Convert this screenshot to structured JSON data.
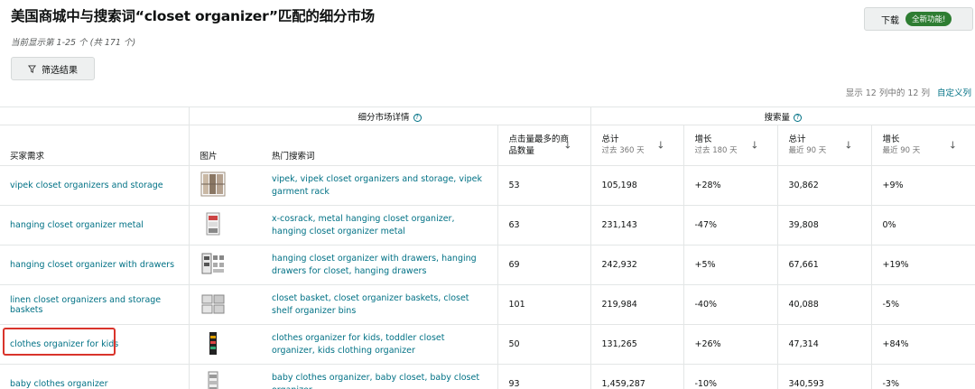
{
  "header": {
    "title": "美国商城中与搜索词“closet organizer”匹配的细分市场",
    "subtitle": "当前显示第 1-25 个 (共 171 个)",
    "download_label": "下载",
    "new_feature_badge": "全新功能!",
    "filter_label": "筛选结果",
    "column_info": "显示 12 列中的 12 列",
    "customize_label": "自定义列"
  },
  "table": {
    "group_headers": {
      "niche_details": "细分市场详情",
      "search_volume": "搜索量"
    },
    "columns": {
      "need": "买家需求",
      "image": "图片",
      "keywords": "热门搜索词",
      "clicked_products": "点击量最多的商品数量",
      "total": "总计",
      "total_sub_360": "过去 360 天",
      "growth": "增长",
      "growth_sub_180": "过去 180 天",
      "total_90": "总计",
      "total_sub_90": "最近 90 天",
      "growth_90": "增长",
      "growth_sub_90": "最近 90 天"
    },
    "rows": [
      {
        "need": "vipek closet organizers and storage",
        "keywords": "vipek, vipek closet organizers and storage, vipek garment rack",
        "clicked": "53",
        "total360": "105,198",
        "growth180": "+28%",
        "total90": "30,862",
        "growth90": "+9%"
      },
      {
        "need": "hanging closet organizer metal",
        "keywords": "x-cosrack, metal hanging closet organizer, hanging closet organizer metal",
        "clicked": "63",
        "total360": "231,143",
        "growth180": "-47%",
        "total90": "39,808",
        "growth90": "0%"
      },
      {
        "need": "hanging closet organizer with drawers",
        "keywords": "hanging closet organizer with drawers, hanging drawers for closet, hanging drawers",
        "clicked": "69",
        "total360": "242,932",
        "growth180": "+5%",
        "total90": "67,661",
        "growth90": "+19%"
      },
      {
        "need": "linen closet organizers and storage baskets",
        "keywords": "closet basket, closet organizer baskets, closet shelf organizer bins",
        "clicked": "101",
        "total360": "219,984",
        "growth180": "-40%",
        "total90": "40,088",
        "growth90": "-5%"
      },
      {
        "need": "clothes organizer for kids",
        "keywords": "clothes organizer for kids, toddler closet organizer, kids clothing organizer",
        "clicked": "50",
        "total360": "131,265",
        "growth180": "+26%",
        "total90": "47,314",
        "growth90": "+84%"
      },
      {
        "need": "baby clothes organizer",
        "keywords": "baby clothes organizer, baby closet, baby closet organizer",
        "clicked": "93",
        "total360": "1,459,287",
        "growth180": "-10%",
        "total90": "340,593",
        "growth90": "-3%"
      }
    ]
  },
  "colors": {
    "link": "#007185",
    "highlight": "#d9342b",
    "badge": "#2e7d32"
  }
}
